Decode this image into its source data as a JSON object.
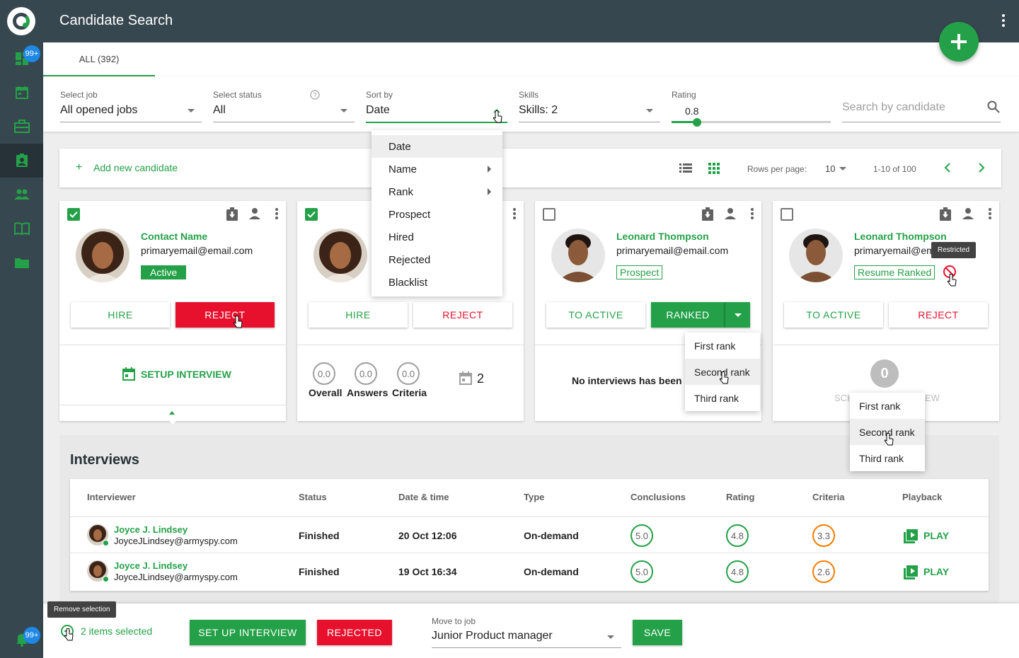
{
  "header": {
    "title": "Candidate Search"
  },
  "sidebar": {
    "badge_top": "99+",
    "badge_bottom": "99+"
  },
  "tabs": {
    "all": "ALL (392)"
  },
  "filters": {
    "job_label": "Select job",
    "job_value": "All opened jobs",
    "status_label": "Select status",
    "status_value": "All",
    "sort_label": "Sort by",
    "sort_value": "Date",
    "skills_label": "Skills",
    "skills_value": "Skills: 2",
    "rating_label": "Rating",
    "rating_value": "0.8",
    "rating_fraction": 0.16,
    "search_placeholder": "Search by candidate"
  },
  "toolbar": {
    "add_plus": "+",
    "add_label": "Add new candidate",
    "rows_label": "Rows per page:",
    "rows_value": "10",
    "range": "1-10 of 100"
  },
  "sort_menu": {
    "items": [
      "Date",
      "Name",
      "Rank",
      "Prospect",
      "Hired",
      "Rejected",
      "Blacklist"
    ]
  },
  "cards": [
    {
      "name": "Contact Name",
      "email": "primaryemail@email.com",
      "status": "Active",
      "btn1": "HIRE",
      "btn2": "REJECT",
      "footer": "SETUP INTERVIEW"
    },
    {
      "btn1": "HIRE",
      "btn2": "REJECT",
      "scores": [
        {
          "value": "0.0",
          "label": "Overall"
        },
        {
          "value": "0.0",
          "label": "Answers"
        },
        {
          "value": "0.0",
          "label": "Criteria"
        }
      ],
      "interview_count": "2"
    },
    {
      "name": "Leonard Thompson",
      "email": "primaryemail@email.com",
      "status": "Prospect",
      "btn1": "TO ACTIVE",
      "btn2": "RANKED",
      "footer": "No interviews has been co"
    },
    {
      "name": "Leonard Thompson",
      "email": "primaryemail@em",
      "status": "Resume Ranked",
      "btn1": "TO ACTIVE",
      "btn2": "REJECT",
      "tooltip": "Restricted",
      "count": "0",
      "footer_left": "SCH",
      "footer_right": "EW"
    }
  ],
  "rank_menu": {
    "items": [
      "First rank",
      "Second rank",
      "Third rank"
    ]
  },
  "interviews": {
    "title": "Interviews",
    "columns": [
      "Interviewer",
      "Status",
      "Date & time",
      "Type",
      "Conclusions",
      "Rating",
      "Criteria",
      "Playback"
    ],
    "rows": [
      {
        "name": "Joyce J. Lindsey",
        "email": "JoyceJLindsey@armyspy.com",
        "status": "Finished",
        "date": "20 Oct 12:06",
        "type": "On-demand",
        "conclusions": "5.0",
        "rating": "4.8",
        "criteria": "3.3",
        "play": "PLAY"
      },
      {
        "name": "Joyce J. Lindsey",
        "email": "JoyceJLindsey@armyspy.com",
        "status": "Finished",
        "date": "19 Oct 16:34",
        "type": "On-demand",
        "conclusions": "5.0",
        "rating": "4.8",
        "criteria": "2.6",
        "play": "PLAY"
      }
    ]
  },
  "bottom": {
    "tooltip": "Remove selection",
    "selected": "2 items selected",
    "setup_btn": "SET UP INTERVIEW",
    "rejected_btn": "REJECTED",
    "move_label": "Move to job",
    "move_value": "Junior Product manager",
    "save_btn": "SAVE"
  },
  "colors": {
    "brand": "#24a148",
    "danger": "#e8112d",
    "sidebar": "#37474f",
    "warning": "#f57c00"
  }
}
